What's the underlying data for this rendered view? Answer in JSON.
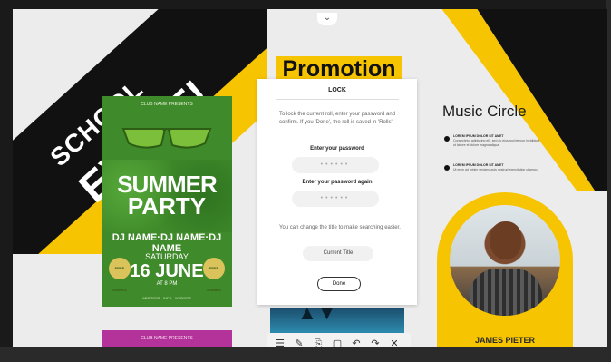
{
  "banner": {
    "line1": "SCHOOL",
    "line2": "EVENT!"
  },
  "screen_handle": {
    "icon": "chevron-down-icon",
    "glyph": "⌄"
  },
  "summer_poster": {
    "presents": "CLUB NAME PRESENTS",
    "title_line1": "SUMMER",
    "title_line2": "PARTY",
    "dj_line": "DJ NAME·DJ NAME·DJ NAME",
    "day": "SATURDAY",
    "date": "16 JUNE",
    "time": "AT 8 PM",
    "badge_left": "FREE DRINKS",
    "badge_right": "FREE DRINKS",
    "footer": "ADDRESS · INFO · WEBSITE"
  },
  "second_poster": {
    "presents": "CLUB NAME PRESENTS"
  },
  "promotion": {
    "title": "Promotion"
  },
  "lock_dialog": {
    "title": "LOCK",
    "description": "To lock the current roll, enter your password and confirm. If you 'Done', the roll is saved in 'Rolls'.",
    "password_label": "Enter your password",
    "password_mask": "••••••",
    "password_again_label": "Enter your password again",
    "password_again_mask": "••••••",
    "change_note": "You can change the title to make searching easier.",
    "current_title": "Current Title",
    "done_label": "Done"
  },
  "toolbar": {
    "items": [
      {
        "icon": "menu-icon",
        "glyph": "☰"
      },
      {
        "icon": "pen-icon",
        "glyph": "✎"
      },
      {
        "icon": "clipboard-icon",
        "glyph": "⎘"
      },
      {
        "icon": "select-icon",
        "glyph": "▢"
      },
      {
        "icon": "undo-icon",
        "glyph": "↶"
      },
      {
        "icon": "redo-icon",
        "glyph": "↷"
      },
      {
        "icon": "close-icon",
        "glyph": "✕"
      }
    ]
  },
  "music_circle": {
    "title": "Music Circle",
    "bullets": [
      {
        "head": "LOREM IPSUM DOLOR SIT AMET",
        "body": "Consectetur adipiscing elit, sed do eiusmod tempor incididunt ut labore et dolore magna aliqua."
      },
      {
        "head": "LOREM IPSUM DOLOR SIT AMET",
        "body": "Ut enim ad minim veniam, quis nostrud exercitation ullamco."
      }
    ],
    "person_name": "JAMES PIETER"
  }
}
